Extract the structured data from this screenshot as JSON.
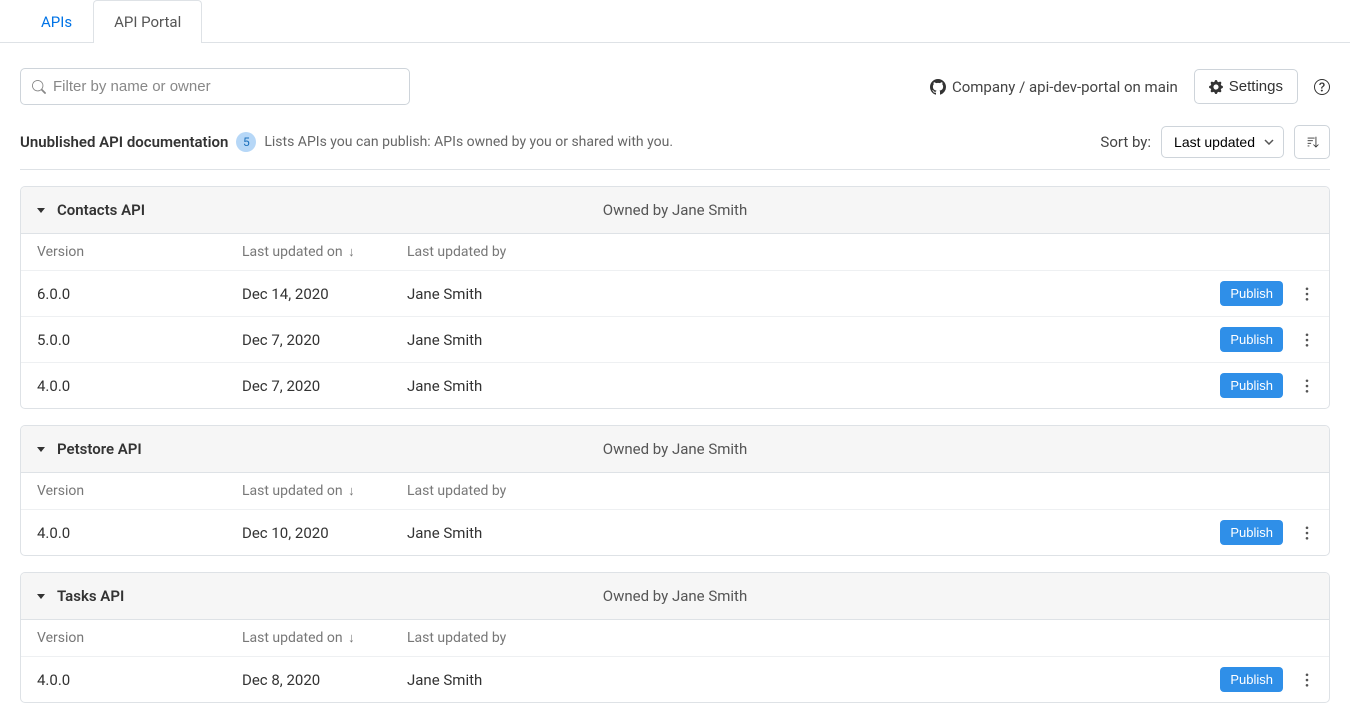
{
  "tabs": {
    "apis": "APIs",
    "portal": "API Portal"
  },
  "filter": {
    "placeholder": "Filter by name or owner"
  },
  "repo": {
    "text": "Company / api-dev-portal on main"
  },
  "settings_label": "Settings",
  "section": {
    "title": "Unublished API documentation",
    "count": "5",
    "description": "Lists APIs you can publish: APIs owned by you or shared with you."
  },
  "sort": {
    "label": "Sort by:",
    "value": "Last updated"
  },
  "columns": {
    "version": "Version",
    "updated_on": "Last updated on",
    "updated_by": "Last updated by"
  },
  "publish_label": "Publish",
  "groups": [
    {
      "name": "Contacts API",
      "owner": "Owned by Jane Smith",
      "rows": [
        {
          "version": "6.0.0",
          "updated_on": "Dec 14, 2020",
          "updated_by": "Jane Smith"
        },
        {
          "version": "5.0.0",
          "updated_on": "Dec 7, 2020",
          "updated_by": "Jane Smith"
        },
        {
          "version": "4.0.0",
          "updated_on": "Dec 7, 2020",
          "updated_by": "Jane Smith"
        }
      ]
    },
    {
      "name": "Petstore API",
      "owner": "Owned by Jane Smith",
      "rows": [
        {
          "version": "4.0.0",
          "updated_on": "Dec 10, 2020",
          "updated_by": "Jane Smith"
        }
      ]
    },
    {
      "name": "Tasks API",
      "owner": "Owned by Jane Smith",
      "rows": [
        {
          "version": "4.0.0",
          "updated_on": "Dec 8, 2020",
          "updated_by": "Jane Smith"
        }
      ]
    }
  ]
}
